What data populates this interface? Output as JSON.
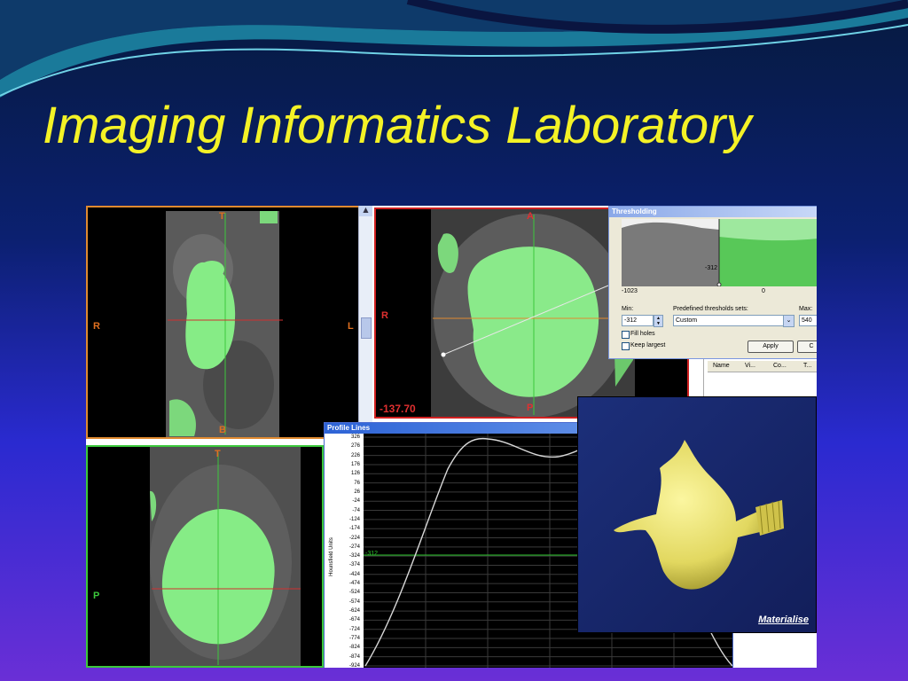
{
  "slide": {
    "title": "Imaging Informatics Laboratory"
  },
  "viewer": {
    "coronal": {
      "top": "T",
      "bottom": "B",
      "left": "R",
      "right": "L"
    },
    "axial": {
      "top": "A",
      "bottom": "P",
      "left": "R",
      "value": "-137.70"
    },
    "sagittal": {
      "top": "T",
      "left": "P"
    }
  },
  "thresholding": {
    "title": "Thresholding",
    "marker_value": "-312",
    "axis_min": "-1023",
    "axis_zero": "0",
    "min_label": "Min:",
    "min_value": "-312",
    "preset_label": "Predefined thresholds sets:",
    "preset_value": "Custom",
    "max_label": "Max:",
    "max_value": "540",
    "fill_holes": "Fill holes",
    "keep_largest": "Keep largest",
    "apply": "Apply",
    "close": "C"
  },
  "object_table": {
    "columns": [
      "Name",
      "Vi...",
      "Co...",
      "T..."
    ]
  },
  "profile": {
    "title": "Profile Lines",
    "y_axis_label": "Hounsfield Units",
    "y_ticks": [
      "326",
      "276",
      "226",
      "176",
      "126",
      "76",
      "26",
      "-24",
      "-74",
      "-124",
      "-174",
      "-224",
      "-274",
      "-324",
      "-374",
      "-424",
      "-474",
      "-524",
      "-574",
      "-624",
      "-674",
      "-724",
      "-774",
      "-824",
      "-874",
      "-924"
    ],
    "marker": "-312"
  },
  "render3d": {
    "logo": "Materialise"
  },
  "colors": {
    "title": "#f4f226",
    "segmentation": "#7cf08a",
    "mesh": "#e6e070",
    "render_bg": "#15256a"
  }
}
